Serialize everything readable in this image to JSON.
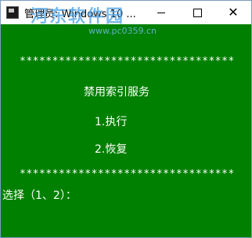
{
  "window": {
    "title": "管理员: Windows 10 ...",
    "watermark_text": "河东软件园",
    "watermark_url": "www.pc0359.cn",
    "controls": {
      "minimize": "minimize",
      "maximize": "maximize",
      "close": "✕"
    }
  },
  "console": {
    "stars_top": "*********************************",
    "heading": "禁用索引服务",
    "option1": "1.执行",
    "option2": "2.恢复",
    "stars_bottom": "*********************************",
    "prompt": "选择（1、2）："
  },
  "colors": {
    "console_bg": "#008000",
    "console_fg": "#ffffff",
    "watermark": "#4da3e6"
  }
}
